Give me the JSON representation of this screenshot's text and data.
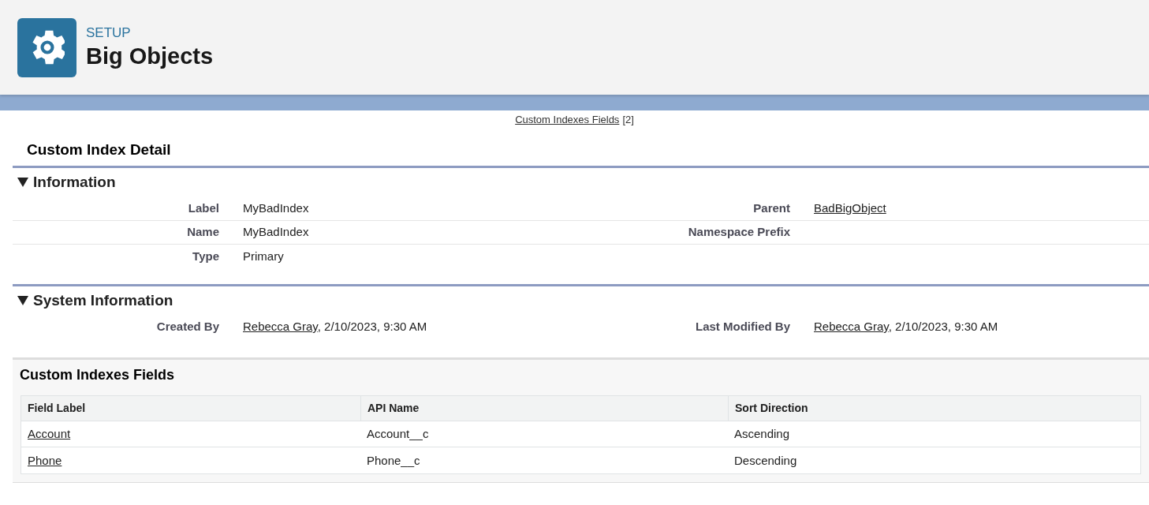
{
  "header": {
    "eyebrow": "SETUP",
    "title": "Big Objects"
  },
  "related_link": {
    "label": "Custom Indexes Fields",
    "count": "[2]"
  },
  "detail": {
    "title": "Custom Index Detail",
    "sections": [
      {
        "title": "Information",
        "expanded": true,
        "rows": [
          {
            "left": {
              "label": "Label",
              "value": "MyBadIndex"
            },
            "right": {
              "label": "Parent",
              "link": "BadBigObject"
            }
          },
          {
            "left": {
              "label": "Name",
              "value": "MyBadIndex"
            },
            "right": {
              "label": "Namespace Prefix"
            }
          },
          {
            "left": {
              "label": "Type",
              "value": "Primary"
            }
          }
        ]
      },
      {
        "title": "System Information",
        "expanded": true,
        "rows": [
          {
            "left": {
              "label": "Created By",
              "link": "Rebecca Gray",
              "value": ", 2/10/2023, 9:30 AM"
            },
            "right": {
              "label": "Last Modified By",
              "link": "Rebecca Gray",
              "value": ", 2/10/2023, 9:30 AM"
            }
          }
        ]
      }
    ]
  },
  "related_list": {
    "title": "Custom Indexes Fields",
    "columns": [
      "Field Label",
      "API Name",
      "Sort Direction"
    ],
    "rows": [
      [
        "Account",
        "Account__c",
        "Ascending"
      ],
      [
        "Phone",
        "Phone__c",
        "Descending"
      ]
    ]
  }
}
